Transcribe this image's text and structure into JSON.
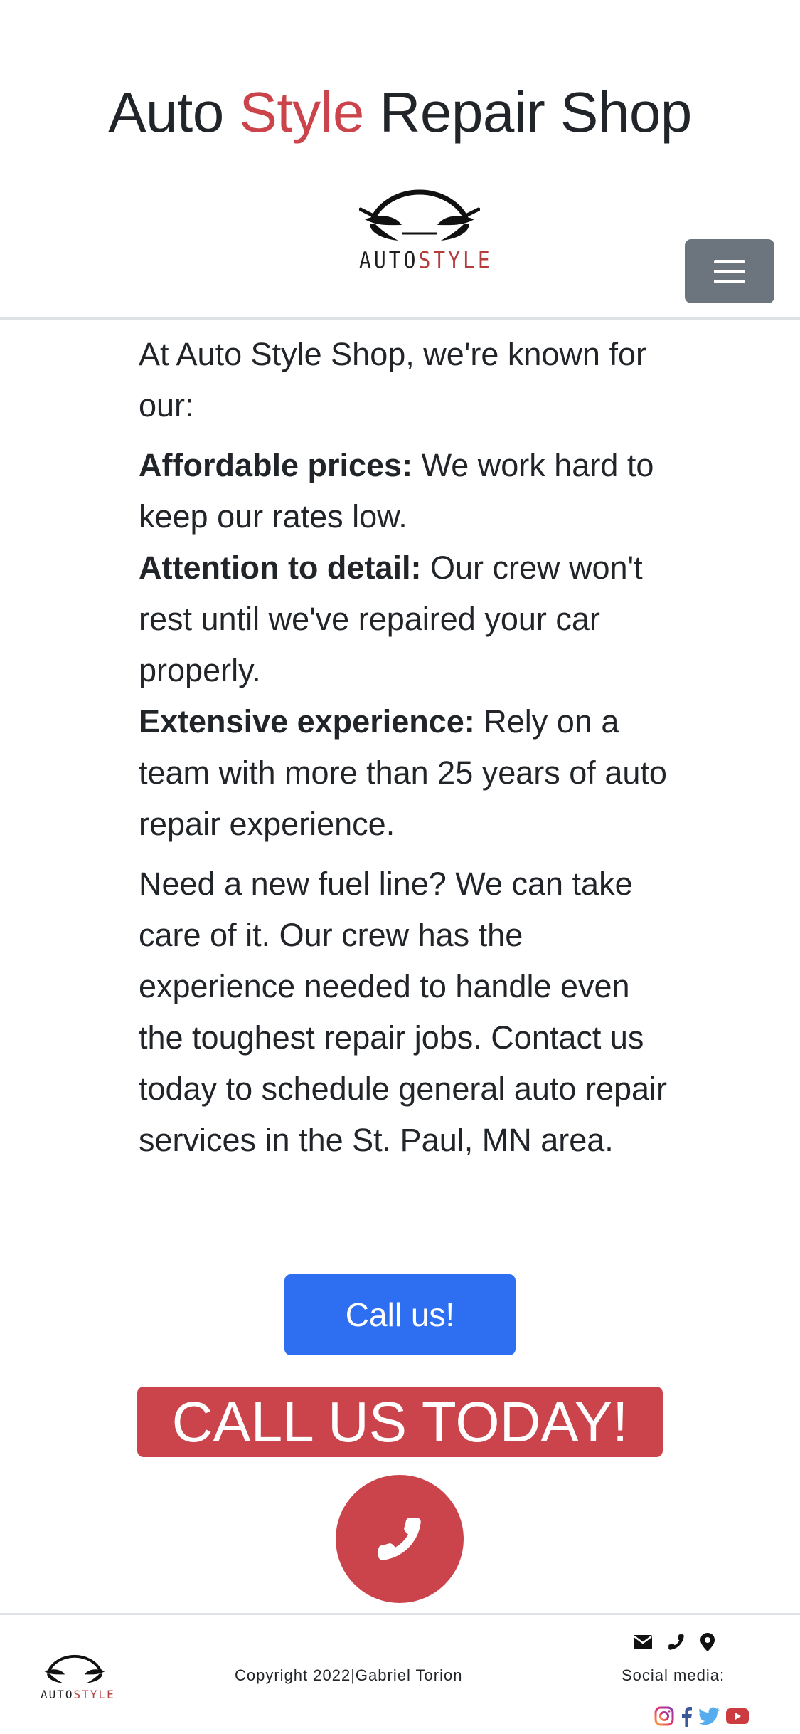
{
  "header": {
    "title_part1": "Auto ",
    "title_accent": "Style",
    "title_part2": " Repair Shop",
    "logo_text_a": "AUTO",
    "logo_text_b": "STYLE",
    "menu_icon": "hamburger-menu-icon"
  },
  "content": {
    "intro": "At Auto Style Shop, we're known for our:",
    "features": [
      {
        "title": "Affordable prices:",
        "text": " We work hard to keep our rates low."
      },
      {
        "title": "Attention to detail:",
        "text": " Our crew won't rest until we've repaired your car properly."
      },
      {
        "title": "Extensive experience:",
        "text": " Rely on a team with more than 25 years of auto repair experience."
      }
    ],
    "paragraph": "Need a new fuel line? We can take care of it. Our crew has the experience needed to handle even the toughest repair jobs. Contact us today to schedule general auto repair services in the St. Paul, MN area."
  },
  "actions": {
    "call_button": "Call us!",
    "call_today": "CALL US TODAY!",
    "phone_icon": "phone-icon"
  },
  "footer": {
    "logo_text_a": "AUTO",
    "logo_text_b": "STYLE",
    "copyright": "Copyright 2022|Gabriel Torion",
    "social_label": "Social media:",
    "contact_icons": [
      "envelope-icon",
      "phone-icon",
      "map-pin-icon"
    ],
    "social_icons": [
      "instagram-icon",
      "facebook-icon",
      "twitter-icon",
      "youtube-icon"
    ]
  },
  "colors": {
    "accent_red": "#cc444b",
    "primary_blue": "#2d6ff0",
    "menu_gray": "#6c757d",
    "text": "#212529"
  }
}
